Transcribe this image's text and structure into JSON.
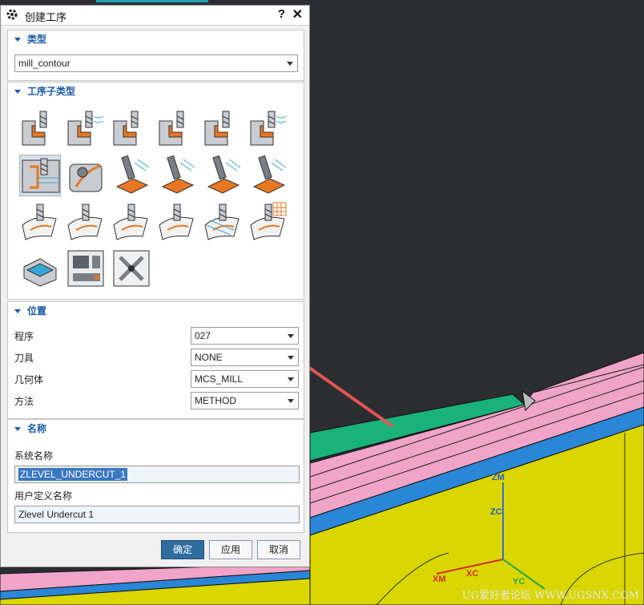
{
  "dialog": {
    "title": "创建工序",
    "help_label": "?",
    "close_label": "✕"
  },
  "type_section": {
    "header": "类型",
    "selected": "mill_contour"
  },
  "subtype_section": {
    "header": "工序子类型"
  },
  "location_section": {
    "header": "位置",
    "rows": [
      {
        "label": "程序",
        "value": "027"
      },
      {
        "label": "刀具",
        "value": "NONE"
      },
      {
        "label": "几何体",
        "value": "MCS_MILL"
      },
      {
        "label": "方法",
        "value": "METHOD"
      }
    ]
  },
  "name_section": {
    "header": "名称",
    "system_name_label": "系统名称",
    "system_name_value": "ZLEVEL_UNDERCUT_1",
    "user_name_label": "用户定义名称",
    "user_name_value": "Zlevel Undercut 1"
  },
  "buttons": {
    "ok": "确定",
    "apply": "应用",
    "cancel": "取消"
  },
  "axes": {
    "zm": "ZM",
    "zc": "ZC",
    "xm": "XM",
    "xc": "XC",
    "yc": "YC"
  },
  "watermark": "UG爱好者论坛 WWW.UGSNX.COM",
  "colors": {
    "accent": "#1a5aa6",
    "arrow": "#e25555",
    "part_pink": "#f0a4c8",
    "part_yellow": "#d9d600",
    "part_blue": "#2a86d6",
    "part_green": "#19b27a"
  }
}
